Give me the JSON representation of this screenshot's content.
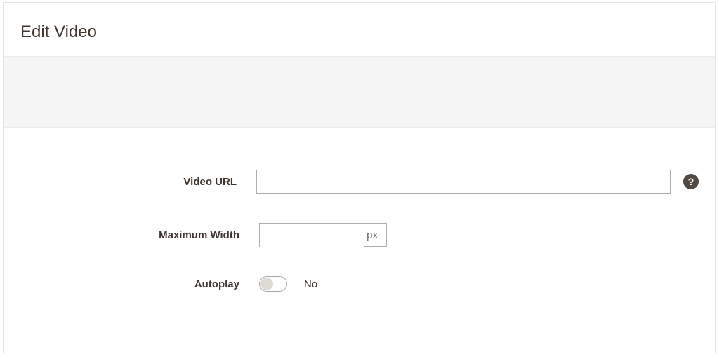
{
  "panel": {
    "title": "Edit Video"
  },
  "fields": {
    "video_url": {
      "label": "Video URL",
      "value": "",
      "help_icon": "?"
    },
    "max_width": {
      "label": "Maximum Width",
      "value": "",
      "unit": "px"
    },
    "autoplay": {
      "label": "Autoplay",
      "state_label": "No"
    }
  }
}
